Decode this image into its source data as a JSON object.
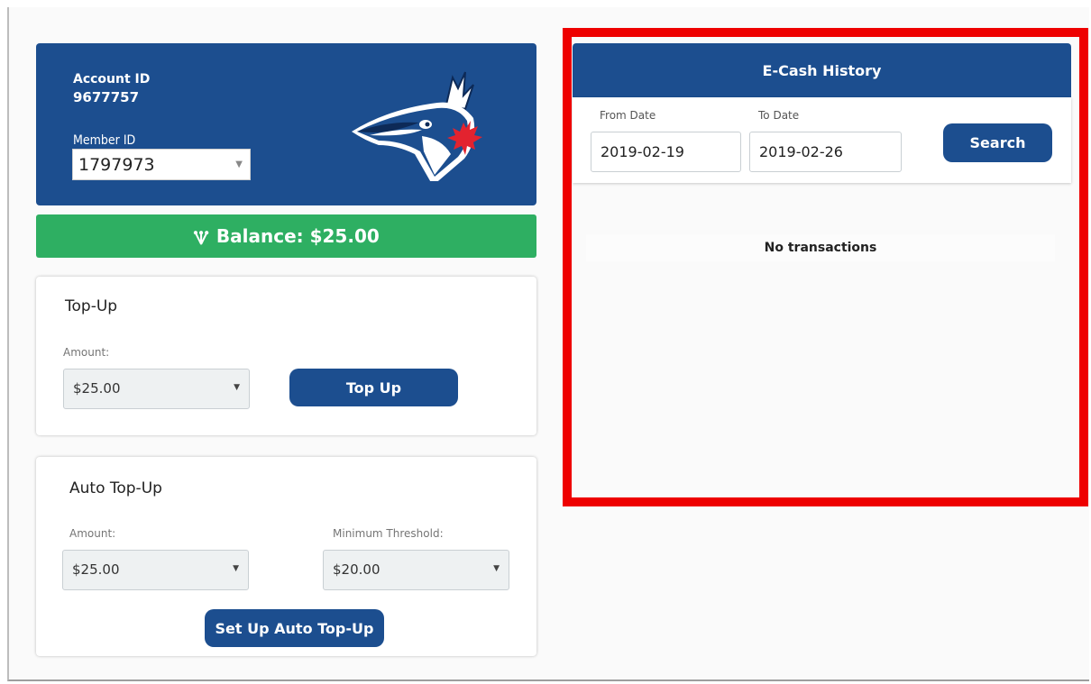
{
  "account": {
    "account_id_label": "Account ID",
    "account_id": "9677757",
    "member_id_label": "Member ID",
    "member_id": "1797973",
    "logo_icon": "blue-jay-logo-icon"
  },
  "balance": {
    "icon": "money-bag-icon",
    "text": "Balance: $25.00",
    "color": "#2eaf62"
  },
  "topup": {
    "title": "Top-Up",
    "amount_label": "Amount:",
    "amount_value": "$25.00",
    "button_label": "Top Up"
  },
  "auto_topup": {
    "title": "Auto Top-Up",
    "amount_label": "Amount:",
    "amount_value": "$25.00",
    "threshold_label": "Minimum Threshold:",
    "threshold_value": "$20.00",
    "button_label": "Set Up Auto Top-Up"
  },
  "history": {
    "title": "E-Cash History",
    "from_label": "From Date",
    "from_value": "2019-02-19",
    "to_label": "To Date",
    "to_value": "2019-02-26",
    "search_label": "Search",
    "empty_text": "No transactions"
  },
  "colors": {
    "brand_blue": "#1c4e8f",
    "highlight_red": "#ee0000"
  }
}
